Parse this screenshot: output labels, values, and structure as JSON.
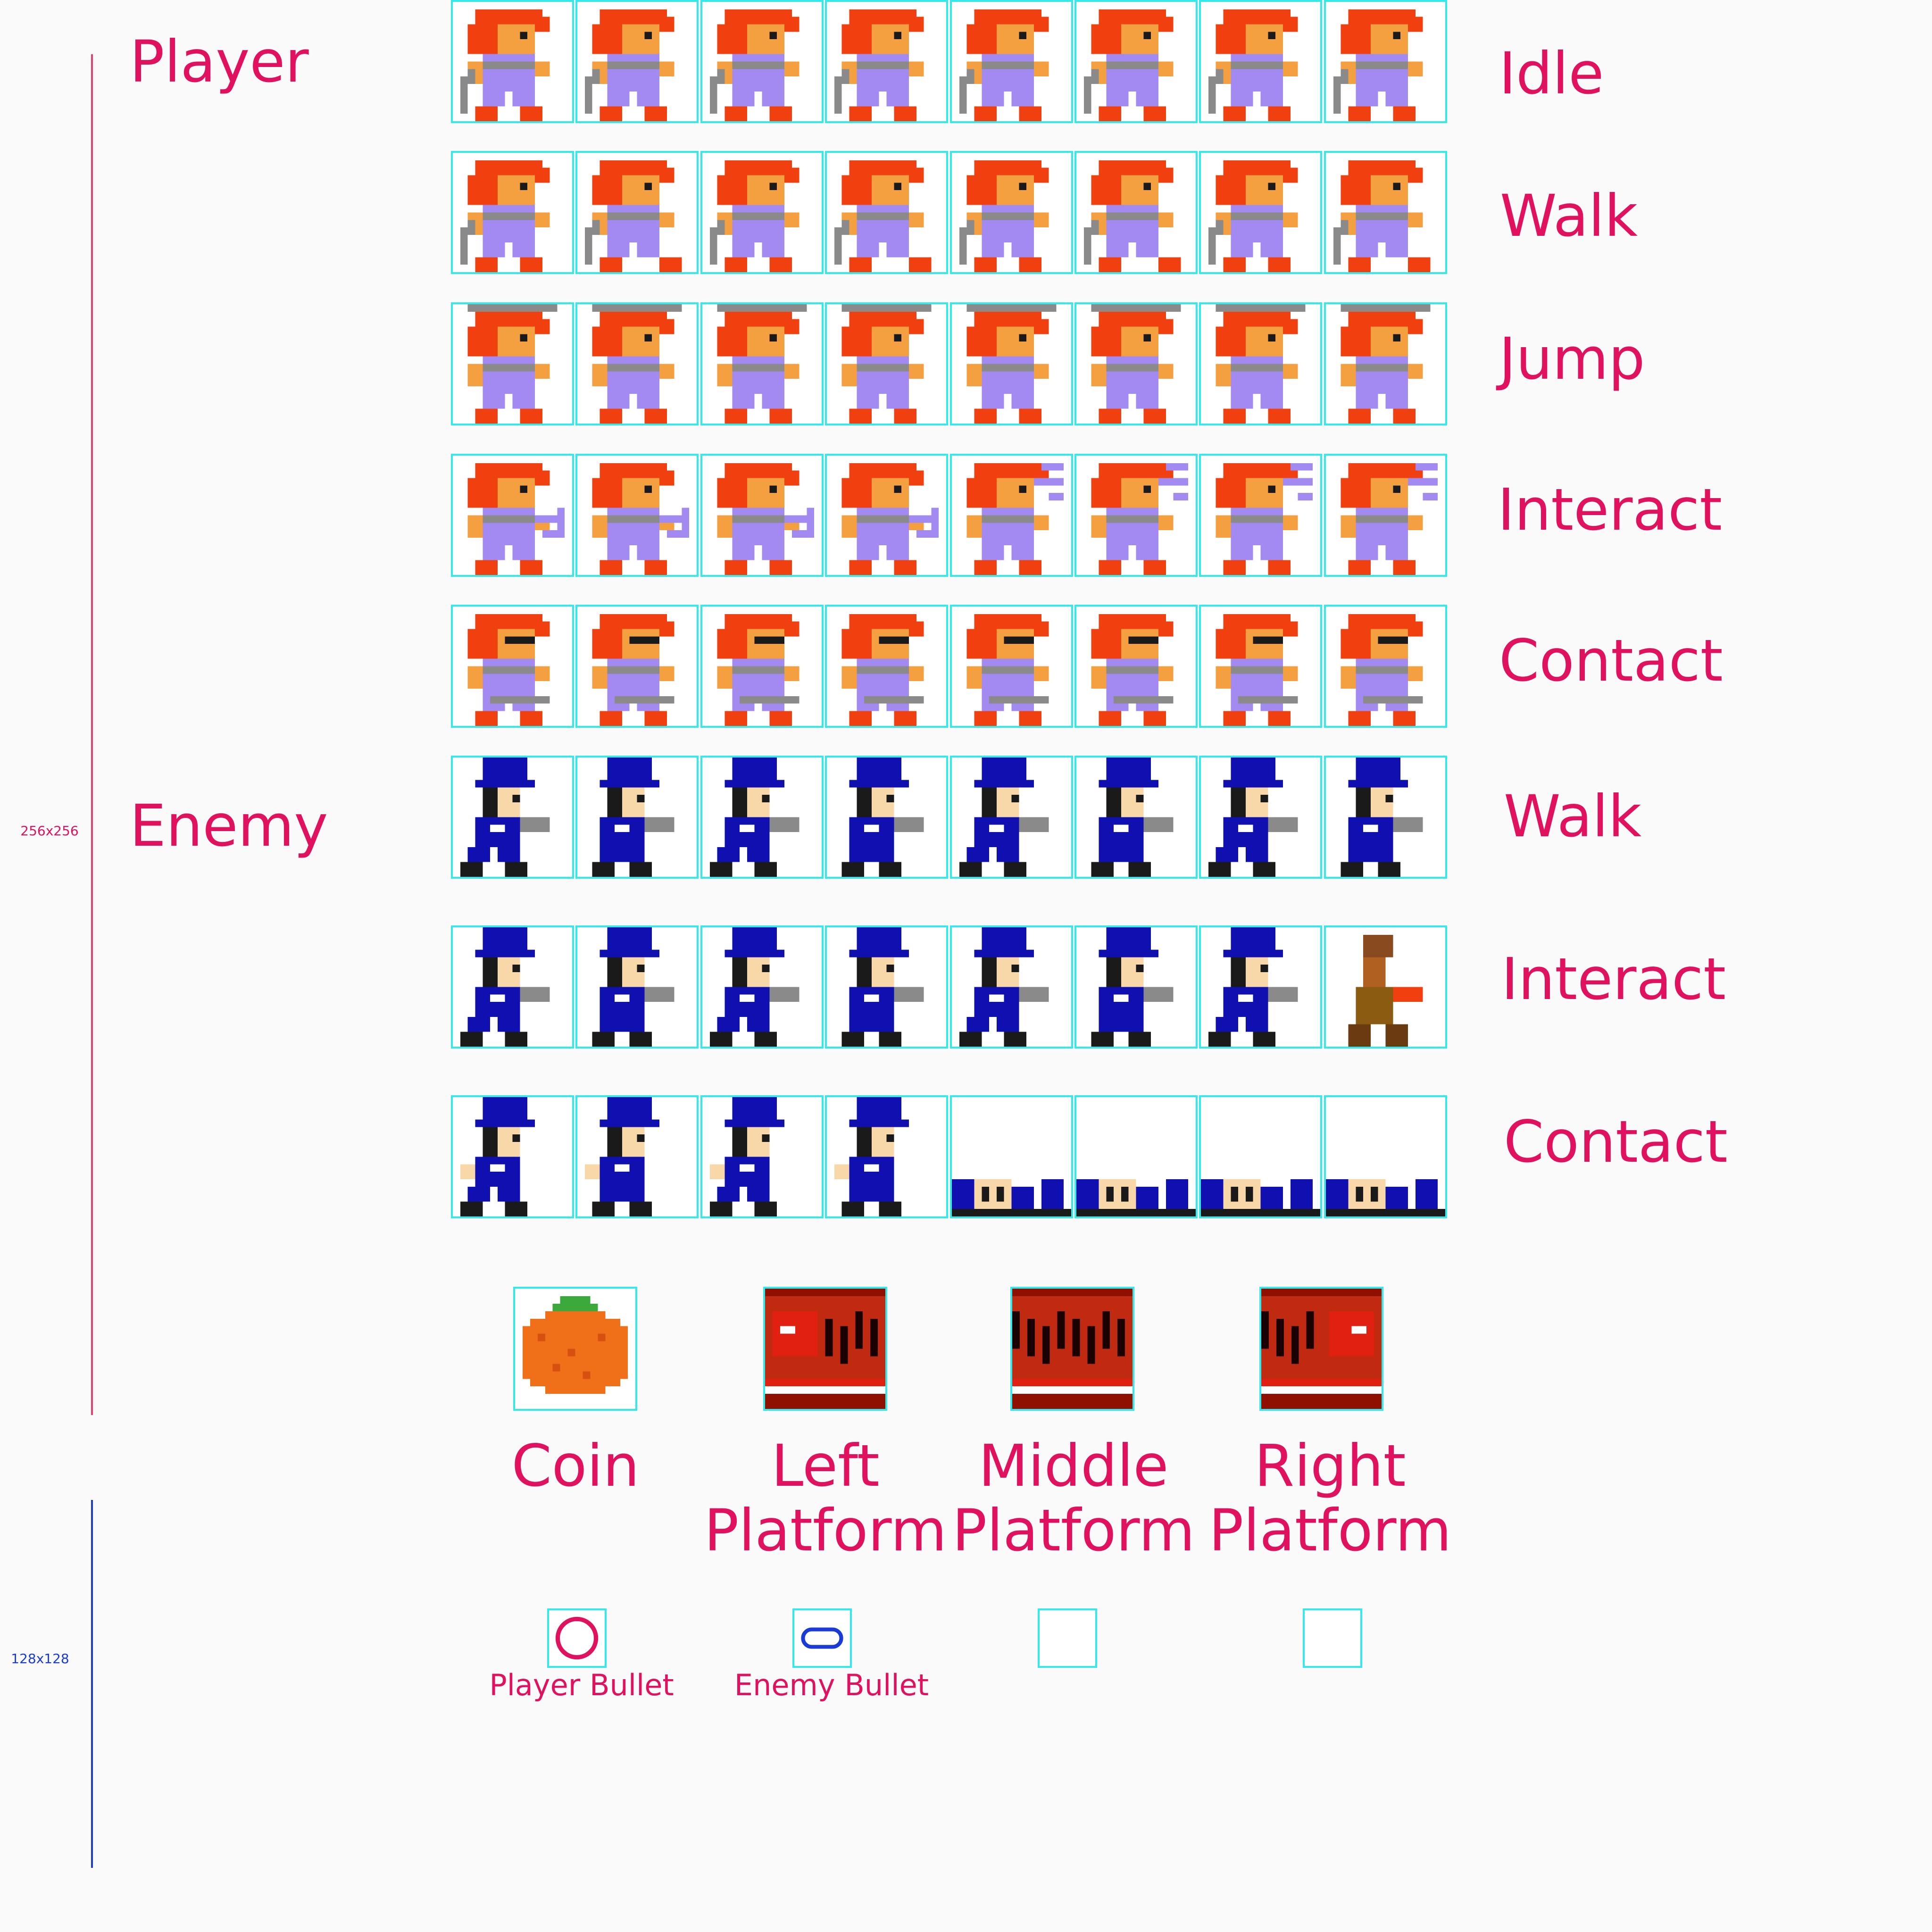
{
  "colors": {
    "label": "#e0115f",
    "guide_256": "#e8406e",
    "guide_128": "#1a3bd6",
    "frame_border": "#33eaea"
  },
  "guides": {
    "size_256": "256x256",
    "size_128": "128x128"
  },
  "sections": {
    "player": "Player",
    "enemy": "Enemy"
  },
  "rows": [
    {
      "label": "Idle",
      "sprite": "player-idle",
      "frames": 8
    },
    {
      "label": "Walk",
      "sprite": "player-walk",
      "frames": 8
    },
    {
      "label": "Jump",
      "sprite": "player-jump",
      "frames": 8
    },
    {
      "label": "Interact",
      "sprite": "player-interact",
      "frames": 8
    },
    {
      "label": "Contact",
      "sprite": "player-contact",
      "frames": 8
    },
    {
      "label": "Walk",
      "sprite": "enemy-walk",
      "frames": 8
    },
    {
      "label": "Interact",
      "sprite": "enemy-interact",
      "frames": 8
    },
    {
      "label": "Contact",
      "sprite": "enemy-contact",
      "frames": 8
    }
  ],
  "tiles": [
    {
      "label": "Coin",
      "sprite": "coin-icon"
    },
    {
      "label": "Left\nPlatform",
      "sprite": "left-platform-icon"
    },
    {
      "label": "Middle\nPlatform",
      "sprite": "middle-platform-icon"
    },
    {
      "label": "Right\nPlatform",
      "sprite": "right-platform-icon"
    }
  ],
  "small_tiles": [
    {
      "label": "Player Bullet",
      "sprite": "player-bullet-icon"
    },
    {
      "label": "Enemy Bullet",
      "sprite": "enemy-bullet-icon"
    },
    {
      "label": "",
      "sprite": "empty-slot"
    },
    {
      "label": "",
      "sprite": "empty-slot"
    }
  ]
}
